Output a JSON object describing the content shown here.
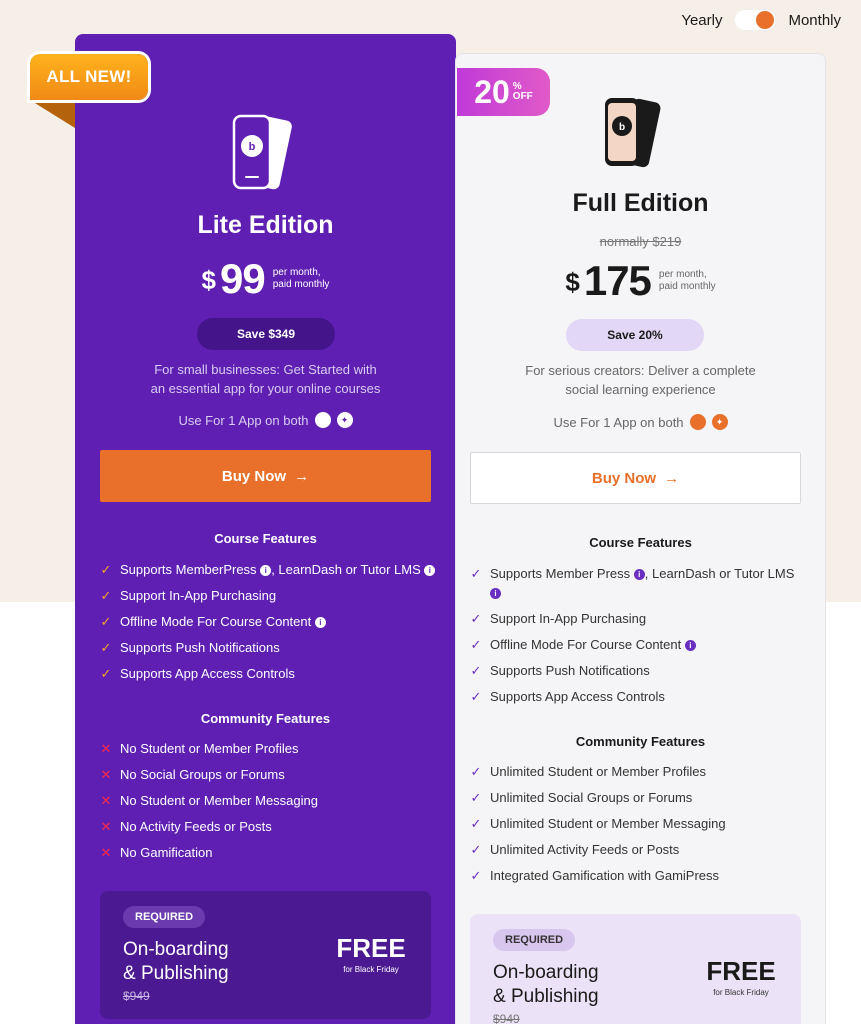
{
  "billing_toggle": {
    "left_label": "Yearly",
    "right_label": "Monthly"
  },
  "colors": {
    "lite_bg": "#5e1fb2",
    "accent": "#e8702a",
    "ribbon": "#f59a1a",
    "discount": "#d04ad0"
  },
  "lite": {
    "badge": "ALL NEW!",
    "title": "Lite Edition",
    "currency": "$",
    "price": "99",
    "per_line1": "per month,",
    "per_line2": "paid monthly",
    "save": "Save $349",
    "desc_line1": "For small businesses: Get Started with",
    "desc_line2": "an essential app for your online courses",
    "use_for": "Use For 1 App on both",
    "buy": "Buy Now",
    "arrow": "→",
    "course_title": "Course Features",
    "course_features": [
      "Supports MemberPress",
      ", LearnDash or Tutor LMS",
      "Support In-App Purchasing",
      "Offline Mode For Course Content",
      "Supports Push Notifications",
      "Supports App Access Controls"
    ],
    "community_title": "Community Features",
    "community_features": [
      "No Student or Member Profiles",
      "No Social Groups or Forums",
      "No Student or Member Messaging",
      "No Activity Feeds or Posts",
      "No Gamification"
    ],
    "onboarding": {
      "required": "REQUIRED",
      "title_line1": "On-boarding",
      "title_line2": "& Publishing",
      "old_price": "$949",
      "free": "FREE",
      "free_sub": "for Black Friday"
    }
  },
  "full": {
    "discount_number": "20",
    "discount_pct": "%",
    "discount_off": "OFF",
    "title": "Full Edition",
    "normally": "normally $219",
    "currency": "$",
    "price": "175",
    "per_line1": "per month,",
    "per_line2": "paid monthly",
    "save": "Save 20%",
    "desc_line1": "For serious creators: Deliver a complete",
    "desc_line2": "social learning experience",
    "use_for": "Use For 1 App on both",
    "buy": "Buy Now",
    "arrow": "→",
    "course_title": "Course Features",
    "course_features": [
      "Supports Member Press",
      ", LearnDash or Tutor LMS",
      "Support In-App Purchasing",
      "Offline Mode For Course Content",
      "Supports Push Notifications",
      "Supports App Access Controls"
    ],
    "community_title": "Community Features",
    "community_features": [
      "Unlimited Student or Member Profiles",
      "Unlimited Social Groups or Forums",
      "Unlimited Student or Member Messaging",
      "Unlimited Activity Feeds or Posts",
      "Integrated Gamification with GamiPress"
    ],
    "onboarding": {
      "required": "REQUIRED",
      "title_line1": "On-boarding",
      "title_line2": "& Publishing",
      "old_price": "$949",
      "free": "FREE",
      "free_sub": "for Black Friday"
    }
  },
  "icons": {
    "check": "✓",
    "cross": "✕",
    "info": "i",
    "apple": "apple-icon",
    "android": "android-icon"
  }
}
